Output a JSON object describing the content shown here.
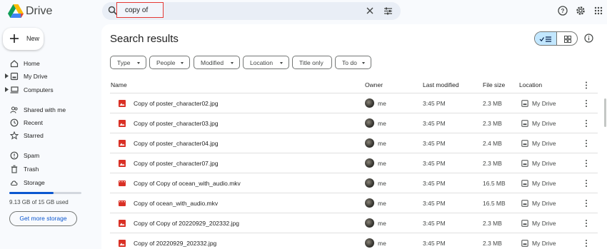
{
  "app": {
    "name": "Drive"
  },
  "search": {
    "query": "copy of"
  },
  "sidebar": {
    "new_label": "New",
    "items": [
      {
        "label": "Home",
        "icon": "home-icon"
      },
      {
        "label": "My Drive",
        "icon": "my-drive-icon"
      },
      {
        "label": "Computers",
        "icon": "computers-icon"
      },
      {
        "label": "Shared with me",
        "icon": "shared-icon"
      },
      {
        "label": "Recent",
        "icon": "clock-icon"
      },
      {
        "label": "Starred",
        "icon": "star-icon"
      },
      {
        "label": "Spam",
        "icon": "spam-icon"
      },
      {
        "label": "Trash",
        "icon": "trash-icon"
      },
      {
        "label": "Storage",
        "icon": "cloud-icon"
      }
    ],
    "storage": {
      "text": "9.13 GB of 15 GB used",
      "used_fraction": 0.61
    },
    "get_storage_label": "Get more storage"
  },
  "main": {
    "title": "Search results",
    "filters": [
      "Type",
      "People",
      "Modified",
      "Location",
      "Title only",
      "To do"
    ],
    "columns": [
      "Name",
      "Owner",
      "Last modified",
      "File size",
      "Location"
    ],
    "rows": [
      {
        "name": "Copy of poster_character02.jpg",
        "kind": "image",
        "owner": "me",
        "modified": "3:45 PM",
        "size": "2.3 MB",
        "location": "My Drive"
      },
      {
        "name": "Copy of poster_character03.jpg",
        "kind": "image",
        "owner": "me",
        "modified": "3:45 PM",
        "size": "2.3 MB",
        "location": "My Drive"
      },
      {
        "name": "Copy of poster_character04.jpg",
        "kind": "image",
        "owner": "me",
        "modified": "3:45 PM",
        "size": "2.4 MB",
        "location": "My Drive"
      },
      {
        "name": "Copy of poster_character07.jpg",
        "kind": "image",
        "owner": "me",
        "modified": "3:45 PM",
        "size": "2.3 MB",
        "location": "My Drive"
      },
      {
        "name": "Copy of Copy of ocean_with_audio.mkv",
        "kind": "video",
        "owner": "me",
        "modified": "3:45 PM",
        "size": "16.5 MB",
        "location": "My Drive"
      },
      {
        "name": "Copy of ocean_with_audio.mkv",
        "kind": "video",
        "owner": "me",
        "modified": "3:45 PM",
        "size": "16.5 MB",
        "location": "My Drive"
      },
      {
        "name": "Copy of Copy of 20220929_202332.jpg",
        "kind": "image",
        "owner": "me",
        "modified": "3:45 PM",
        "size": "2.3 MB",
        "location": "My Drive"
      },
      {
        "name": "Copy of 20220929_202332.jpg",
        "kind": "image",
        "owner": "me",
        "modified": "3:45 PM",
        "size": "2.3 MB",
        "location": "My Drive"
      }
    ]
  },
  "colors": {
    "accent": "#0b57d0",
    "file_red": "#d93025",
    "selected_toggle": "#c2e7ff",
    "search_highlight": "#e53935"
  }
}
